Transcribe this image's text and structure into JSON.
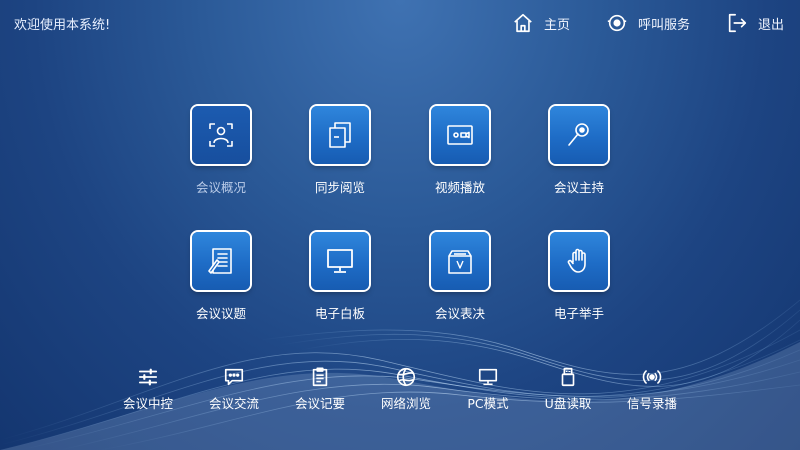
{
  "header": {
    "welcome": "欢迎使用本系统!",
    "nav": [
      {
        "label": "主页",
        "icon": "home-icon"
      },
      {
        "label": "呼叫服务",
        "icon": "service-call-icon"
      },
      {
        "label": "退出",
        "icon": "exit-icon"
      }
    ]
  },
  "tiles": [
    {
      "label": "会议概况",
      "icon": "meeting-overview-icon",
      "active": true
    },
    {
      "label": "同步阅览",
      "icon": "sync-documents-icon"
    },
    {
      "label": "视频播放",
      "icon": "video-play-icon"
    },
    {
      "label": "会议主持",
      "icon": "microphone-icon"
    },
    {
      "label": "会议议题",
      "icon": "agenda-edit-icon"
    },
    {
      "label": "电子白板",
      "icon": "whiteboard-monitor-icon"
    },
    {
      "label": "会议表决",
      "icon": "vote-box-icon"
    },
    {
      "label": "电子举手",
      "icon": "raise-hand-icon"
    }
  ],
  "bottom_bar": [
    {
      "label": "会议中控",
      "icon": "control-sliders-icon"
    },
    {
      "label": "会议交流",
      "icon": "chat-bubble-icon"
    },
    {
      "label": "会议记要",
      "icon": "notes-clipboard-icon"
    },
    {
      "label": "网络浏览",
      "icon": "globe-icon"
    },
    {
      "label": "PC模式",
      "icon": "pc-monitor-icon"
    },
    {
      "label": "U盘读取",
      "icon": "usb-drive-icon"
    },
    {
      "label": "信号录播",
      "icon": "signal-broadcast-icon"
    }
  ],
  "colors": {
    "background_top": "#3f72b2",
    "background_bottom": "#143670",
    "tile_button": "#1e6cc6",
    "tile_active": "#174f9e",
    "text": "#ffffff"
  }
}
